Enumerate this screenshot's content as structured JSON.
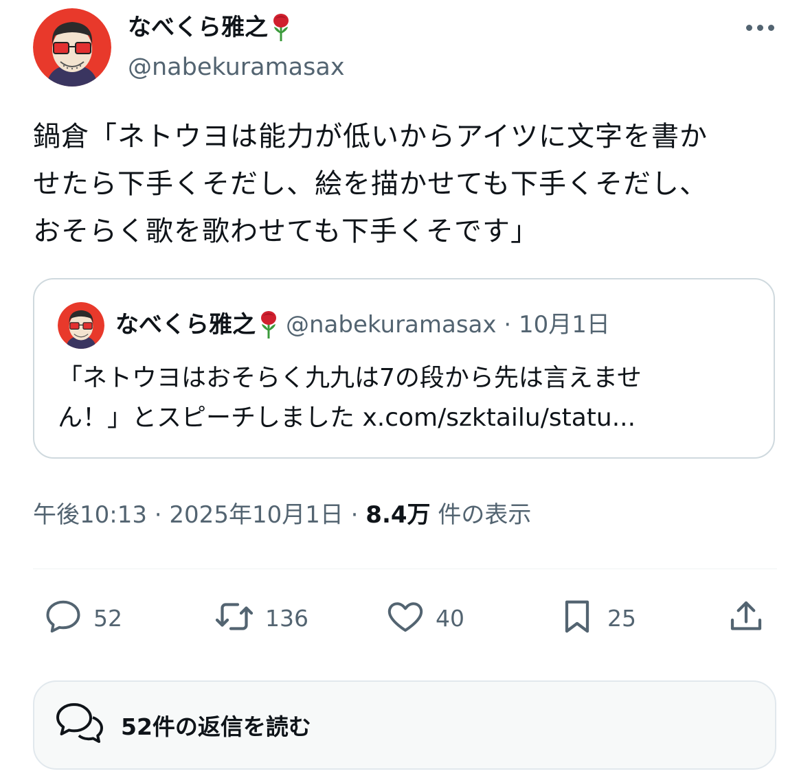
{
  "author": {
    "display_name": "なべくら雅之",
    "handle": "@nabekuramasax"
  },
  "tweet": {
    "lines": [
      "鍋倉「ネトウヨは能力が低いからアイツに文字を書か",
      "せたら下手くそだし、絵を描かせても下手くそだし、",
      "おそらく歌を歌わせても下手くそです」"
    ]
  },
  "quote": {
    "display_name": "なべくら雅之",
    "meta": "@nabekuramasax · 10月1日",
    "lines": [
      "「ネトウヨはおそらく九九は7の段から先は言えませ",
      "ん！」とスピーチしました x.com/szktailu/statu..."
    ]
  },
  "meta_line": {
    "time": "午後10:13",
    "separator": " · ",
    "date": "2025年10月1日",
    "separator2": " · ",
    "views": "8.4万",
    "views_label": " 件の表示"
  },
  "actions": {
    "replies": "52",
    "reposts": "136",
    "likes": "40",
    "bookmarks": "25"
  },
  "read_replies": "52件の返信を読む",
  "colors": {
    "secondary_text": "#536471",
    "primary_text": "#0f1419",
    "border": "#cfd9de",
    "avatar_bg": "#e8392b"
  },
  "icons": [
    "more-icon",
    "rose-emoji-icon",
    "reply-icon",
    "repost-icon",
    "like-icon",
    "bookmark-icon",
    "share-icon",
    "replies-bubble-icon"
  ]
}
